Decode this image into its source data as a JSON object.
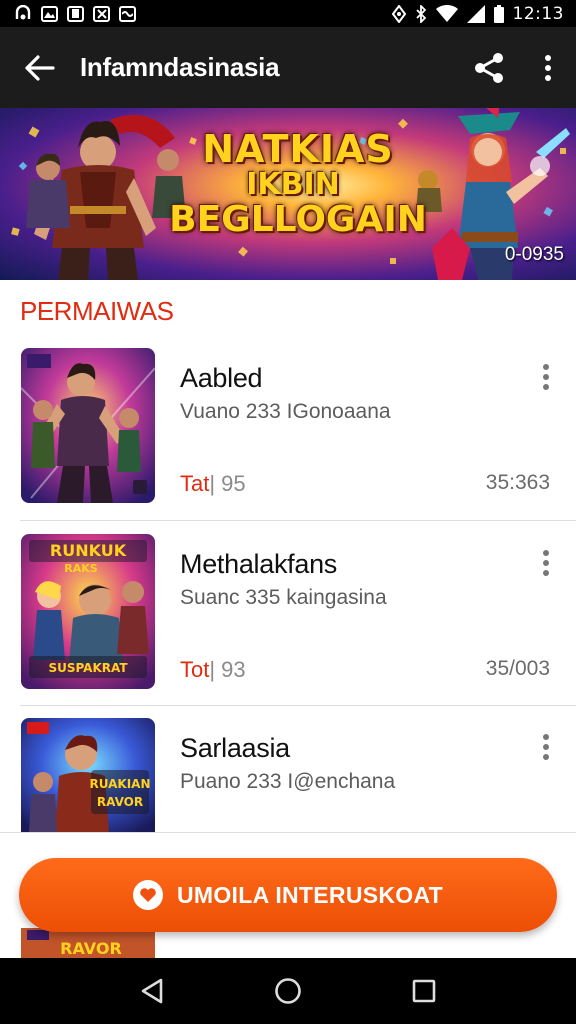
{
  "status_bar": {
    "time": "12:13",
    "left_icons": [
      "notification-icon",
      "photo-icon",
      "notification-icon",
      "photo-icon",
      "message-icon"
    ],
    "right_icons": [
      "vibrate-icon",
      "bluetooth-icon",
      "wifi-icon",
      "signal-icon",
      "battery-icon"
    ]
  },
  "app_bar": {
    "title": "Infamndasinasia",
    "back_icon": "arrow-left-icon",
    "share_icon": "share-icon",
    "more_icon": "more-vertical-icon"
  },
  "banner": {
    "headline_line1": "NATKIAS",
    "headline_line2": "IKBIN",
    "headline_line3": "BEGLLOGAIN",
    "price": "0-0935"
  },
  "section": {
    "title": "PERMAIWAS"
  },
  "cards": [
    {
      "title": "Aabled",
      "subtitle": "Vuano 233 IGonoaana",
      "label": "Tat",
      "label_suffix": "| 95",
      "meta": "35:363"
    },
    {
      "title": "Methalakfans",
      "subtitle": "Suanc 335 kaingasina",
      "label": "Tot",
      "label_suffix": "| 93",
      "meta": "35/003"
    },
    {
      "title": "Sarlaasia",
      "subtitle": "Puano 233 I@enchana"
    }
  ],
  "thumbnails": [
    {
      "caption_top": "",
      "caption_bottom": ""
    },
    {
      "caption_top": "RUNKUK",
      "caption_sub": "RAKS",
      "caption_bottom": "SUSPAKRAT"
    },
    {
      "caption_top": "RUAKIAN",
      "caption_sub": "RAVOR",
      "caption_bottom": ""
    },
    {
      "caption_top": "RAVOR",
      "caption_bottom": ""
    }
  ],
  "cta": {
    "label": "UMOILA INTERUSKOAT",
    "icon": "heart-icon"
  },
  "nav_bar": {
    "back_icon": "nav-back-icon",
    "home_icon": "nav-home-icon",
    "recents_icon": "nav-recents-icon"
  },
  "colors": {
    "accent": "#e02c10",
    "cta": "#f05a10",
    "app_bar": "#1c1c1c"
  }
}
